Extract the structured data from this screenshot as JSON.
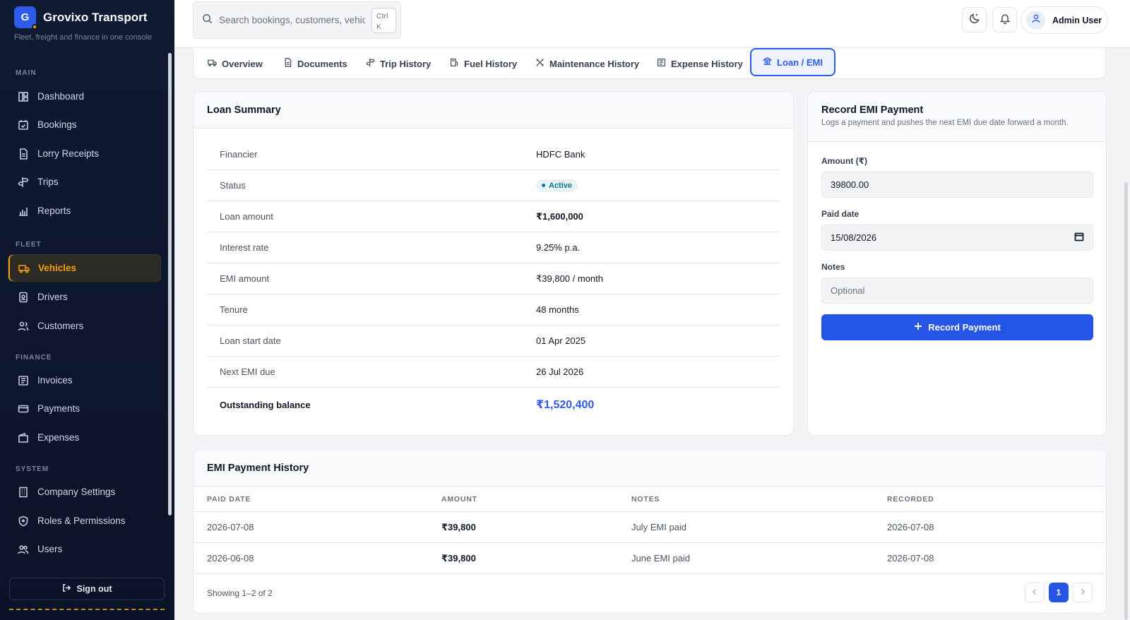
{
  "brand": {
    "initial": "G",
    "name": "Grovixo Transport",
    "tagline": "Fleet, freight and finance in one console"
  },
  "sidebar": {
    "sections": {
      "main": "MAIN",
      "fleet": "FLEET",
      "finance": "FINANCE",
      "system": "SYSTEM"
    },
    "items": [
      {
        "label": "Dashboard",
        "icon": "dashboard-icon"
      },
      {
        "label": "Bookings",
        "icon": "calendar-check-icon"
      },
      {
        "label": "Lorry Receipts",
        "icon": "receipt-icon"
      },
      {
        "label": "Trips",
        "icon": "signpost-icon"
      },
      {
        "label": "Reports",
        "icon": "bar-chart-icon"
      },
      {
        "label": "Vehicles",
        "icon": "truck-icon"
      },
      {
        "label": "Drivers",
        "icon": "id-badge-icon"
      },
      {
        "label": "Customers",
        "icon": "users-icon"
      },
      {
        "label": "Invoices",
        "icon": "invoice-icon"
      },
      {
        "label": "Payments",
        "icon": "credit-card-icon"
      },
      {
        "label": "Expenses",
        "icon": "wallet-icon"
      },
      {
        "label": "Company Settings",
        "icon": "building-icon"
      },
      {
        "label": "Roles & Permissions",
        "icon": "shield-icon"
      },
      {
        "label": "Users",
        "icon": "users-group-icon"
      }
    ],
    "active": "Vehicles",
    "sign_out": "Sign out"
  },
  "header": {
    "search_placeholder": "Search bookings, customers, vehicles",
    "shortcut_line1": "Ctrl",
    "shortcut_line2": "K",
    "user_name": "Admin User"
  },
  "tabs": [
    {
      "label": "Overview",
      "icon": "truck-icon"
    },
    {
      "label": "Documents",
      "icon": "file-icon"
    },
    {
      "label": "Trip History",
      "icon": "signpost-icon"
    },
    {
      "label": "Fuel History",
      "icon": "fuel-icon"
    },
    {
      "label": "Maintenance History",
      "icon": "wrench-icon"
    },
    {
      "label": "Expense History",
      "icon": "receipt-icon"
    },
    {
      "label": "Loan / EMI",
      "icon": "bank-icon"
    }
  ],
  "loan_summary": {
    "title": "Loan Summary",
    "rows": [
      {
        "label": "Financier",
        "value": "HDFC Bank"
      },
      {
        "label": "Status",
        "value": "Active"
      },
      {
        "label": "Loan amount",
        "value": "₹1,600,000"
      },
      {
        "label": "Interest rate",
        "value": "9.25% p.a."
      },
      {
        "label": "EMI amount",
        "value": "₹39,800 / month"
      },
      {
        "label": "Tenure",
        "value": "48 months"
      },
      {
        "label": "Loan start date",
        "value": "01 Apr 2025"
      },
      {
        "label": "Next EMI due",
        "value": "26 Jul 2026"
      },
      {
        "label": "Outstanding balance",
        "value": "₹1,520,400"
      }
    ]
  },
  "record_emi": {
    "title": "Record EMI Payment",
    "subtitle": "Logs a payment and pushes the next EMI due date forward a month.",
    "amount_label": "Amount (₹)",
    "amount_value": "39800.00",
    "date_label": "Paid date",
    "date_value": "15/08/2026",
    "notes_label": "Notes",
    "notes_placeholder": "Optional",
    "submit": "Record Payment"
  },
  "history": {
    "title": "EMI Payment History",
    "columns": [
      "PAID DATE",
      "AMOUNT",
      "NOTES",
      "RECORDED"
    ],
    "rows": [
      [
        "2026-07-08",
        "₹39,800",
        "July EMI paid",
        "2026-07-08"
      ],
      [
        "2026-06-08",
        "₹39,800",
        "June EMI paid",
        "2026-07-08"
      ]
    ],
    "footer": "Showing 1–2 of 2",
    "current_page": "1"
  },
  "colors": {
    "accent": "#2555e6",
    "active_nav": "#f59e0b",
    "sidebar_bg": "#0f1a33"
  }
}
